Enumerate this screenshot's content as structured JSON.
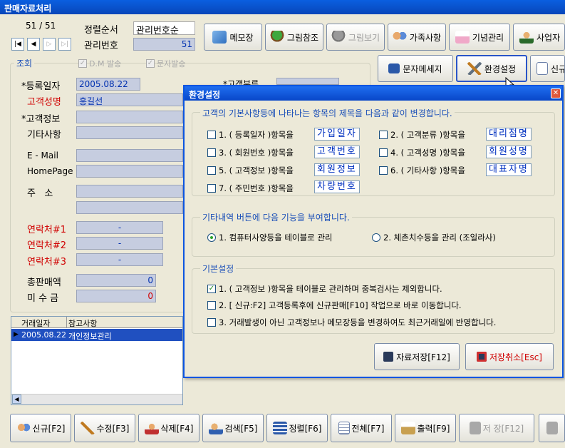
{
  "window": {
    "title": "판매자료처리"
  },
  "record": {
    "counter": "51 / 51",
    "sort_label": "정렬순서",
    "sort_value": "관리번호순",
    "id_label": "관리번호",
    "id_value": "51"
  },
  "nav": {
    "first": "|◀",
    "prev": "◀",
    "next": "▷",
    "last": "▷|"
  },
  "toolbar": {
    "memo": "메모장",
    "image_ref": "그림참조",
    "image_view": "그림보기",
    "family": "가족사항",
    "anniversary": "기념관리",
    "business": "사업자",
    "sms": "문자메세지",
    "settings": "환경설정",
    "new_partial": "신규"
  },
  "inquiry": {
    "group_title": "조회",
    "dm_label": "D.M 발송",
    "sms_label": "문자발송",
    "reg_date_label": "*등록일자",
    "reg_date_value": "2005.08.22",
    "customer_class_partial": "*고객분류",
    "customer_name_label": "고객성명",
    "customer_name_value": "홍길선",
    "customer_info_label": "*고객정보",
    "misc_label": "기타사항",
    "email_label": "E - Mail",
    "homepage_label": "HomePage",
    "address_label": "주   소",
    "contact1_label": "연락처#1",
    "contact1_value": "-",
    "contact2_label": "연락처#2",
    "contact2_value": "-",
    "contact3_label": "연락처#3",
    "contact3_value": "-",
    "total_sales_label": "총판매액",
    "total_sales_value": "0",
    "receivable_label": "미 수 금",
    "receivable_value": "0"
  },
  "grid": {
    "headers": [
      "거래일자",
      "참고사항"
    ],
    "rows": [
      [
        "2005.08.22",
        "개인정보관리"
      ]
    ]
  },
  "bottom": {
    "new": "신규[F2]",
    "edit": "수정[F3]",
    "delete": "삭제[F4]",
    "search": "검색[F5]",
    "sort": "정렬[F6]",
    "all": "전체[F7]",
    "print": "출력[F9]",
    "save": "저 장[F12]"
  },
  "dialog": {
    "title": "환경설정",
    "section1_title": "고객의 기본사항등에 나타나는 항목의 제목을 다음과 같이 변경합니다.",
    "items": [
      {
        "label": "1. ( 등록일자 )항목을",
        "value": "가입일자",
        "checked": false
      },
      {
        "label": "2. ( 고객분류 )항목을",
        "value": "대리점명",
        "checked": false
      },
      {
        "label": "3. ( 회원번호 )항목을",
        "value": "고객번호",
        "checked": false
      },
      {
        "label": "4. ( 고객성명 )항목을",
        "value": "회원성명",
        "checked": false
      },
      {
        "label": "5. ( 고객정보 )항목을",
        "value": "회원정보",
        "checked": false
      },
      {
        "label": "6. ( 기타사항 )항목을",
        "value": "대표자명",
        "checked": false
      },
      {
        "label": "7. ( 주민번호 )항목을",
        "value": "차량번호",
        "checked": false
      }
    ],
    "section2_title": "기타내역 버튼에 다음 기능을 부여합니다.",
    "radio1": "1. 컴퓨터사양등을 테이블로 관리",
    "radio2": "2. 체촌치수등을 관리 (조일라사)",
    "section3_title": "기본설정",
    "opt1": "1. ( 고객정보 )항목을 테이블로 관리하며 중복검사는 제외합니다.",
    "opt2": "2. [ 신규:F2] 고객등록후에 신규판매[F10] 작업으로 바로 이동합니다.",
    "opt3": "3. 거래발생이 아닌 고객정보나 메모장등을 변경하여도 최근거래일에 반영합니다.",
    "save_button": "자료저장[F12]",
    "cancel_button": "저장취소[Esc]"
  },
  "colors": {
    "titlebar": "#0846b9",
    "field": "#c6cde0",
    "accent_red": "#d00000",
    "dialog_border": "#0b55e1"
  }
}
